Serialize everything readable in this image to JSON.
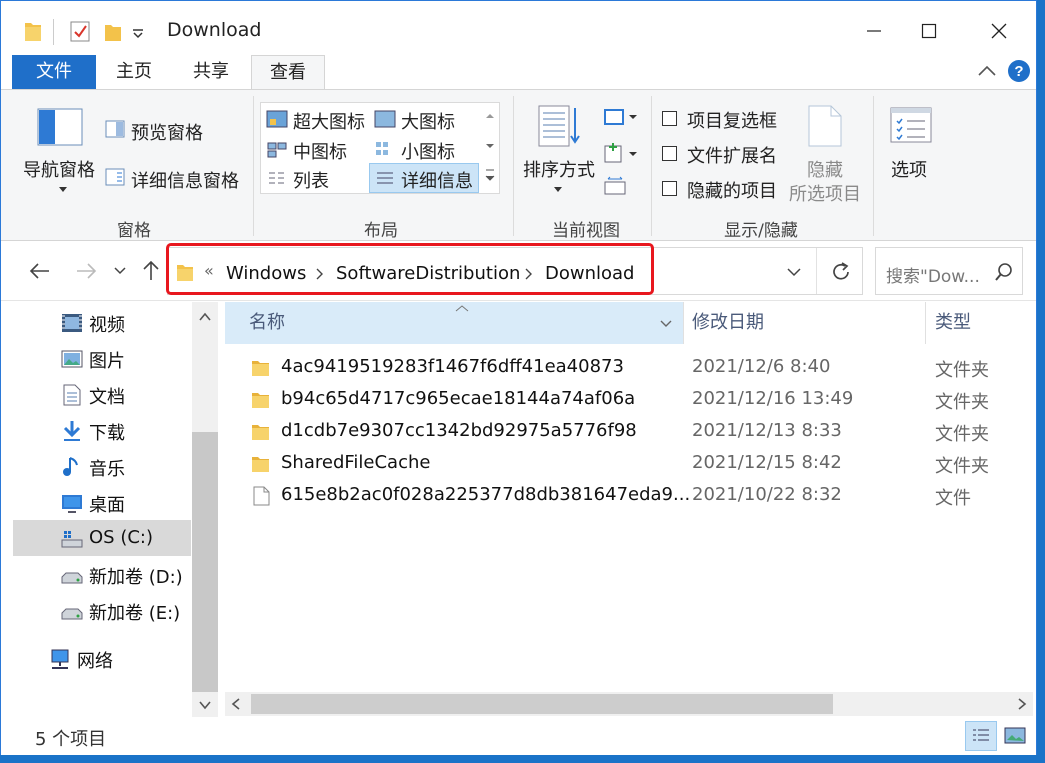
{
  "window": {
    "title": "Download"
  },
  "tabs": [
    "文件",
    "主页",
    "共享",
    "查看"
  ],
  "ribbon": {
    "panes": {
      "label": "窗格",
      "nav_pane": "导航窗格",
      "preview_pane": "预览窗格",
      "details_pane": "详细信息窗格"
    },
    "layout": {
      "label": "布局",
      "options": [
        "超大图标",
        "大图标",
        "中图标",
        "小图标",
        "列表",
        "详细信息"
      ],
      "selected": "详细信息"
    },
    "current_view": {
      "label": "当前视图",
      "sort_by": "排序方式"
    },
    "show_hide": {
      "label": "显示/隐藏",
      "item_checkboxes": "项目复选框",
      "file_extensions": "文件扩展名",
      "hidden_items": "隐藏的项目",
      "hide_selected_line1": "隐藏",
      "hide_selected_line2": "所选项目"
    },
    "options": "选项"
  },
  "address": {
    "overflow": "«",
    "crumbs": [
      "Windows",
      "SoftwareDistribution",
      "Download"
    ]
  },
  "search": {
    "placeholder": "搜索\"Dow..."
  },
  "sidebar": {
    "items": [
      {
        "label": "视频",
        "icon": "video-icon"
      },
      {
        "label": "图片",
        "icon": "pictures-icon"
      },
      {
        "label": "文档",
        "icon": "documents-icon"
      },
      {
        "label": "下载",
        "icon": "download-icon"
      },
      {
        "label": "音乐",
        "icon": "music-icon"
      },
      {
        "label": "桌面",
        "icon": "desktop-icon"
      },
      {
        "label": "OS (C:)",
        "icon": "drive-c-icon",
        "selected": true
      },
      {
        "label": "新加卷 (D:)",
        "icon": "drive-icon"
      },
      {
        "label": "新加卷 (E:)",
        "icon": "drive-icon"
      },
      {
        "label": "网络",
        "icon": "network-icon"
      }
    ]
  },
  "columns": {
    "name": "名称",
    "date": "修改日期",
    "type": "类型"
  },
  "files": [
    {
      "name": "4ac9419519283f1467f6dff41ea40873",
      "date": "2021/12/6 8:40",
      "type": "文件夹",
      "kind": "folder"
    },
    {
      "name": "b94c65d4717c965ecae18144a74af06a",
      "date": "2021/12/16 13:49",
      "type": "文件夹",
      "kind": "folder"
    },
    {
      "name": "d1cdb7e9307cc1342bd92975a5776f98",
      "date": "2021/12/13 8:33",
      "type": "文件夹",
      "kind": "folder"
    },
    {
      "name": "SharedFileCache",
      "date": "2021/12/15 8:42",
      "type": "文件夹",
      "kind": "folder"
    },
    {
      "name": "615e8b2ac0f028a225377d8db381647eda9...",
      "date": "2021/10/22 8:32",
      "type": "文件",
      "kind": "file"
    }
  ],
  "status": {
    "count": "5 个项目"
  },
  "colors": {
    "accent": "#1f6fc9",
    "highlight": "#e8171e",
    "folder": "#f3c24a"
  }
}
